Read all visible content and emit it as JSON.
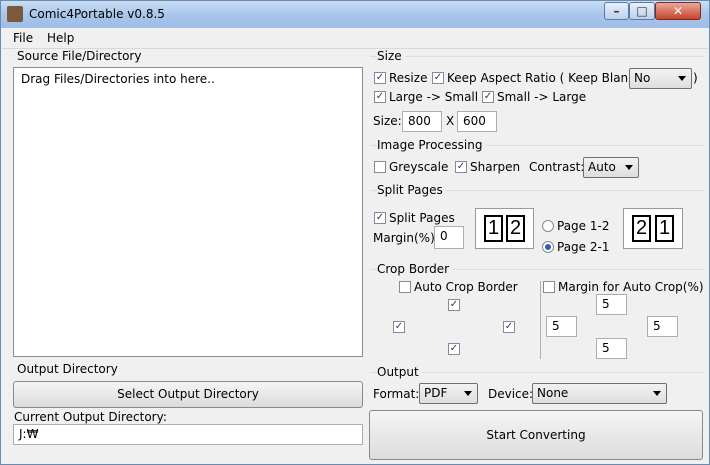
{
  "window": {
    "title": "Comic4Portable v0.8.5"
  },
  "menu": {
    "file": "File",
    "help": "Help"
  },
  "source": {
    "label": "Source File/Directory",
    "placeholder": "Drag Files/Directories into here.."
  },
  "output_dir": {
    "label": "Output Directory",
    "button": "Select Output Directory",
    "current_label": "Current Output Directory:",
    "current_value": "J:₩"
  },
  "size": {
    "group_label": "Size",
    "resize_label": "Resize",
    "resize_checked": true,
    "keep_aspect_label": "Keep Aspect Ratio ( Keep Blank:",
    "keep_aspect_checked": true,
    "keep_blank_value": "No",
    "keep_blank_close": ")",
    "large_small_label": "Large -> Small",
    "large_small_checked": true,
    "small_large_label": "Small -> Large",
    "small_large_checked": true,
    "size_label": "Size:",
    "width": "800",
    "x_label": "X",
    "height": "600"
  },
  "image_processing": {
    "group_label": "Image Processing",
    "greyscale_label": "Greyscale",
    "greyscale_checked": false,
    "sharpen_label": "Sharpen",
    "sharpen_checked": true,
    "contrast_label": "Contrast:",
    "contrast_value": "Auto"
  },
  "split_pages": {
    "group_label": "Split Pages",
    "split_label": "Split Pages",
    "split_checked": true,
    "margin_label": "Margin(%):",
    "margin_value": "0",
    "order_a_label": "Page 1-2",
    "order_b_label": "Page 2-1",
    "selected_order": "Page 2-1",
    "icon_a": [
      "1",
      "2"
    ],
    "icon_b": [
      "2",
      "1"
    ]
  },
  "crop_border": {
    "group_label": "Crop Border",
    "auto_crop_label": "Auto Crop Border",
    "auto_crop_checked": false,
    "side_checks": {
      "top": true,
      "left": true,
      "right": true,
      "bottom": true
    },
    "margin_auto_label": "Margin for Auto Crop(%)",
    "margin_auto_checked": false,
    "margin_top": "5",
    "margin_left": "5",
    "margin_right": "5",
    "margin_bottom": "5"
  },
  "output": {
    "group_label": "Output",
    "format_label": "Format:",
    "format_value": "PDF",
    "device_label": "Device:",
    "device_value": "None",
    "start_button": "Start Converting"
  }
}
